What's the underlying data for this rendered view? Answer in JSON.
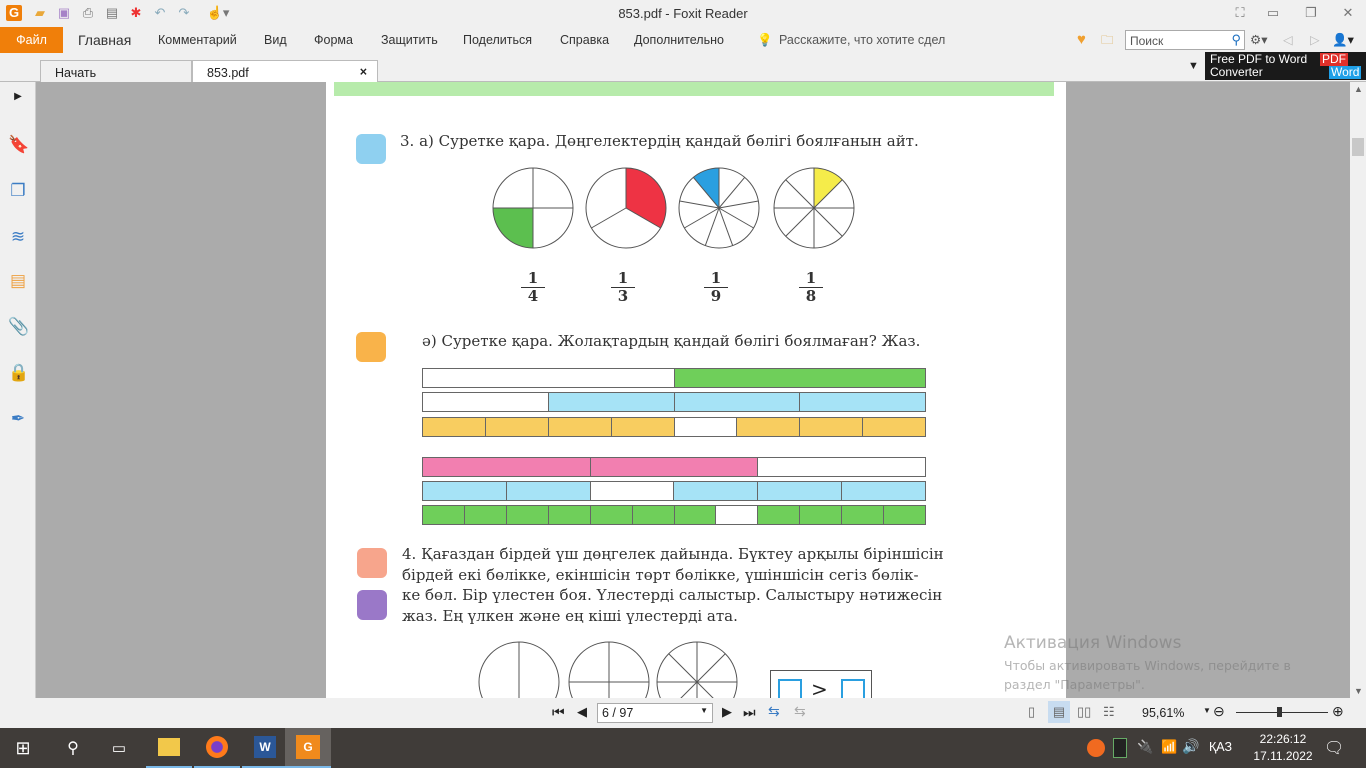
{
  "window": {
    "title": "853.pdf - Foxit Reader"
  },
  "menu": {
    "items": [
      "Файл",
      "Главная",
      "Комментарий",
      "Вид",
      "Форма",
      "Защитить",
      "Поделиться",
      "Справка",
      "Дополнительно"
    ],
    "tell_me": "Расскажите, что хотите сдел",
    "search_placeholder": "Поиск"
  },
  "tabs": [
    {
      "label": "Начать"
    },
    {
      "label": "853.pdf"
    }
  ],
  "ad": {
    "line1": "Free PDF to Word",
    "line2": "Converter",
    "badge_pdf": "PDF",
    "badge_word": "Word"
  },
  "content": {
    "task3a": "3. а) Суретке қара. Дөңгелектердің қандай бөлігі боялғанын айт.",
    "circles": [
      {
        "parts": 4,
        "shaded": "bottom-left",
        "color": "#5cbf4f",
        "num": "1",
        "den": "4"
      },
      {
        "parts": 3,
        "color": "#ee3344",
        "num": "1",
        "den": "3"
      },
      {
        "parts": 9,
        "color": "#2a9fe0",
        "num": "1",
        "den": "9"
      },
      {
        "parts": 8,
        "color": "#f5ec4a",
        "num": "1",
        "den": "8"
      }
    ],
    "task3b": "ә) Суретке қара. Жолақтардың қандай бөлігі боялмаған? Жаз.",
    "bars": [
      {
        "parts": 2,
        "blank": [
          0
        ],
        "color": "#6fcf5a"
      },
      {
        "parts": 4,
        "blank": [
          0
        ],
        "color": "#a6e3f6"
      },
      {
        "parts": 8,
        "blank": [
          4
        ],
        "color": "#f8cd60"
      },
      {
        "parts": 3,
        "blank": [
          2
        ],
        "color": "#f27fb0"
      },
      {
        "parts": 6,
        "blank": [
          2
        ],
        "color": "#a6e3f6"
      },
      {
        "parts": 12,
        "blank": [
          7
        ],
        "color": "#6fcf5a"
      }
    ],
    "task4": [
      "4. Қағаздан бірдей үш дөңгелек дайында. Бүктеу арқылы біріншісін",
      "бірдей екі бөлікке, екіншісін төрт бөлікке, үшіншісін сегіз бөлік-",
      "ке  бөл. Бір үлестен боя. Үлестерді салыстыр. Салыстыру нәтижесін",
      "жаз. Ең үлкен және ең кіші үлестерді ата."
    ],
    "compare_sign": ">"
  },
  "status": {
    "page": "6 / 97",
    "zoom": "95,61%",
    "zoom_fraction": 0.45
  },
  "watermark": {
    "title": "Активация Windows",
    "line1": "Чтобы активировать Windows, перейдите в",
    "line2": "раздел \"Параметры\"."
  },
  "taskbar": {
    "lang": "ҚАЗ",
    "time": "22:26:12",
    "date": "17.11.2022"
  }
}
